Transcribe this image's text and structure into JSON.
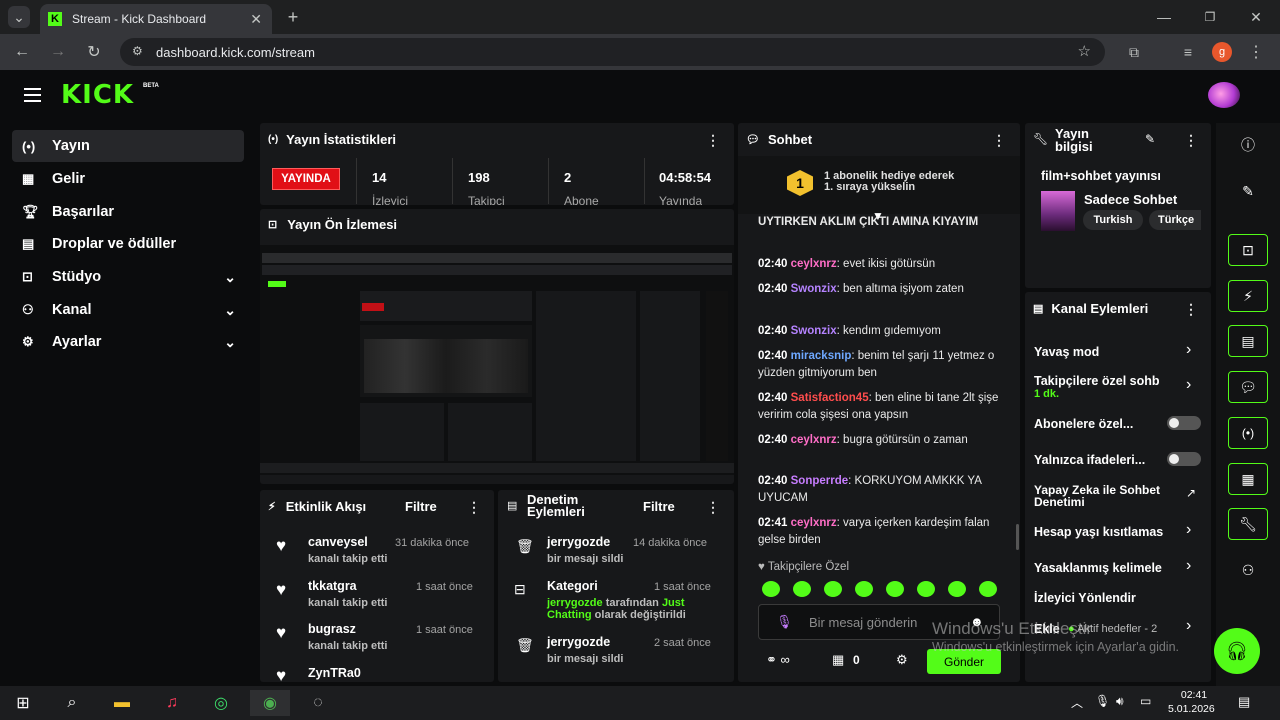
{
  "browser": {
    "tab_title": "Stream - Kick Dashboard",
    "url": "dashboard.kick.com/stream",
    "profile_initial": "g"
  },
  "brand": {
    "logo": "KICK",
    "beta": "BETA",
    "accent": "#53fc18"
  },
  "sidebar": {
    "items": [
      {
        "label": "Yayın",
        "icon": "broadcast-icon"
      },
      {
        "label": "Gelir",
        "icon": "revenue-icon"
      },
      {
        "label": "Başarılar",
        "icon": "trophy-icon"
      },
      {
        "label": "Droplar ve ödüller",
        "icon": "gift-icon"
      },
      {
        "label": "Stüdyo",
        "icon": "studio-icon"
      },
      {
        "label": "Kanal",
        "icon": "channel-icon"
      },
      {
        "label": "Ayarlar",
        "icon": "settings-icon"
      }
    ]
  },
  "stats": {
    "title": "Yayın İstatistikleri",
    "live_badge": "YAYINDA",
    "items": [
      {
        "value": "14",
        "label": "İzleyici"
      },
      {
        "value": "198",
        "label": "Takipçi"
      },
      {
        "value": "2",
        "label": "Abone"
      },
      {
        "value": "04:58:54",
        "label": "Yayında"
      }
    ]
  },
  "preview": {
    "title": "Yayın Ön İzlemesi"
  },
  "activity": {
    "title": "Etkinlik Akışı",
    "filter": "Filtre",
    "items": [
      {
        "name": "canveysel",
        "sub": "kanalı takip etti",
        "time": "31 dakika önce"
      },
      {
        "name": "tkkatgra",
        "sub": "kanalı takip etti",
        "time": "1 saat önce"
      },
      {
        "name": "bugrasz",
        "sub": "kanalı takip etti",
        "time": "1 saat önce"
      },
      {
        "name": "ZynTRa0",
        "sub": "",
        "time": ""
      }
    ]
  },
  "moderation": {
    "title_line1": "Denetim",
    "title_line2": "Eylemleri",
    "filter": "Filtre",
    "items": [
      {
        "name": "jerrygozde",
        "time": "14 dakika önce",
        "sub": "bir mesajı sildi"
      },
      {
        "name": "Kategori",
        "time": "1 saat önce",
        "green": "jerrygozde",
        "mid": " tarafından ",
        "green2": "Just Chatting",
        "tail": " olarak değiştirildi"
      },
      {
        "name": "jerrygozde",
        "time": "2 saat önce",
        "sub": "bir mesajı sildi"
      }
    ]
  },
  "chat": {
    "title": "Sohbet",
    "gift_line1": "1 abonelik hediye ederek",
    "gift_line2": "1. sıraya yükselin",
    "gift_rank": "1",
    "partial": "UYTIRKEN AKLIM ÇIKTI AMINA KIYAYIM",
    "messages": [
      {
        "time": "02:40",
        "user": "ceylxnrz",
        "color": "#ff6ec7",
        "text": "evet ikisi götürsün"
      },
      {
        "time": "02:40",
        "user": "Swonzix",
        "color": "#b583ff",
        "text": "ben altıma işiyom zaten"
      },
      {
        "time": "02:40",
        "user": "Swonzix",
        "color": "#b583ff",
        "text": "kendım gıdemıyom"
      },
      {
        "time": "02:40",
        "user": "miracksnip",
        "color": "#6ea8ff",
        "text": "benim tel şarjı 11 yetmez o yüzden gitmiyorum ben"
      },
      {
        "time": "02:40",
        "user": "Satisfaction45",
        "color": "#ff4d4d",
        "text": "ben eline bi tane 2lt şişe veririm cola şişesi ona yapsın"
      },
      {
        "time": "02:40",
        "user": "ceylxnrz",
        "color": "#ff6ec7",
        "text": "bugra götürsün o zaman"
      },
      {
        "time": "02:40",
        "user": "Sonperrde",
        "color": "#c77dff",
        "text": "KORKUYOM AMKKK YA UYUCAM"
      },
      {
        "time": "02:41",
        "user": "ceylxnrz",
        "color": "#ff6ec7",
        "text": "varya içerken kardeşim falan gelse birden"
      }
    ],
    "followers_only": "Takipçilere Özel",
    "input_placeholder": "Bir mesaj gönderin",
    "count_value": "0",
    "send": "Gönder"
  },
  "stream_info": {
    "title_line1": "Yayın",
    "title_line2": "bilgisi",
    "stream_title": "film+sohbet yayınısı",
    "category": "Sadece Sohbet",
    "tags": [
      "Turkish",
      "Türkçe"
    ]
  },
  "channel_actions": {
    "title": "Kanal Eylemleri",
    "items": [
      {
        "label": "Yavaş mod",
        "kind": "arrow"
      },
      {
        "label": "Takipçilere özel sohb",
        "sub": "1 dk.",
        "kind": "arrow"
      },
      {
        "label": "Abonelere özel...",
        "kind": "toggle"
      },
      {
        "label": "Yalnızca ifadeleri...",
        "kind": "toggle"
      },
      {
        "label": "Yapay Zeka ile Sohbet Denetimi",
        "kind": "external"
      },
      {
        "label": "Hesap yaşı kısıtlamas",
        "kind": "arrow"
      },
      {
        "label": "Yasaklanmış kelimele",
        "kind": "arrow"
      },
      {
        "label": "İzleyici Yönlendir",
        "kind": "none"
      },
      {
        "label": "Ekle",
        "sub": "Aktif hedefler - 2",
        "kind": "arrow"
      }
    ]
  },
  "watermark": {
    "line1": "Windows'u Etkinleştir",
    "line2": "Windows'u etkinleştirmek için Ayarlar'a gidin."
  },
  "taskbar": {
    "time": "02:41",
    "date": "5.01.2026"
  }
}
